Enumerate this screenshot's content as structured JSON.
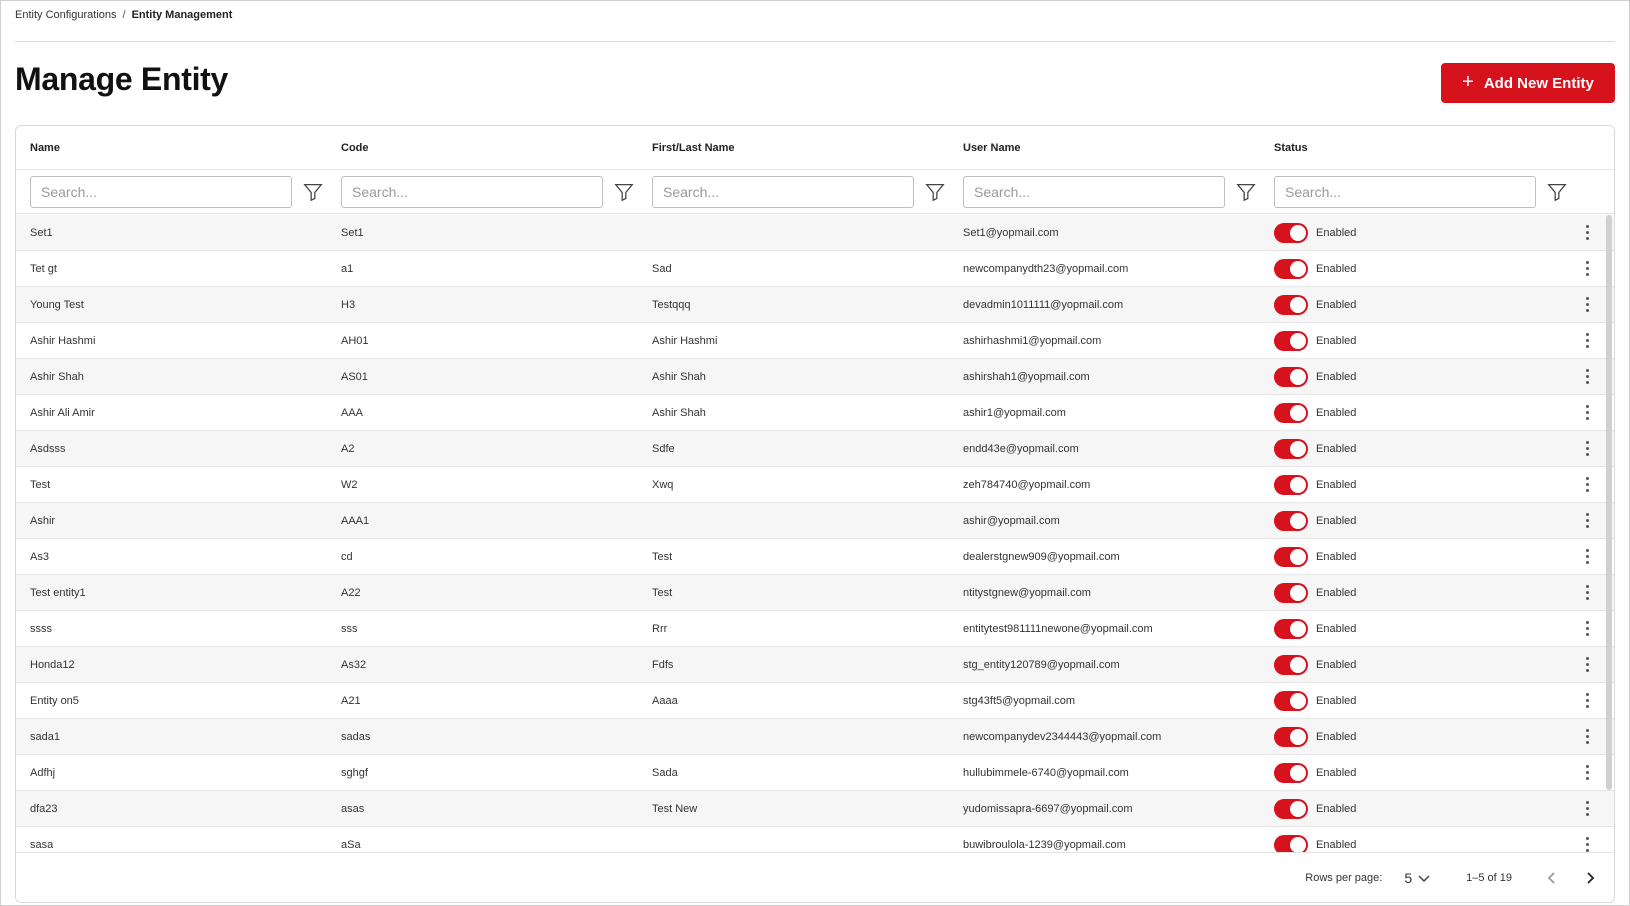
{
  "breadcrumb": {
    "parent": "Entity Configurations",
    "separator": "/",
    "current": "Entity Management"
  },
  "page": {
    "title": "Manage Entity"
  },
  "actions": {
    "add_label": "Add New Entity"
  },
  "table": {
    "columns": {
      "name": "Name",
      "code": "Code",
      "first_last": "First/Last Name",
      "username": "User Name",
      "status": "Status"
    },
    "search_placeholder": "Search...",
    "rows": [
      {
        "name": "Set1",
        "code": "Set1",
        "first_last": "",
        "username": "Set1@yopmail.com",
        "status": "Enabled"
      },
      {
        "name": "Tet gt",
        "code": "a1",
        "first_last": "Sad",
        "username": "newcompanydth23@yopmail.com",
        "status": "Enabled"
      },
      {
        "name": "Young Test",
        "code": "H3",
        "first_last": "Testqqq",
        "username": "devadmin1011111@yopmail.com",
        "status": "Enabled"
      },
      {
        "name": "Ashir Hashmi",
        "code": "AH01",
        "first_last": "Ashir Hashmi",
        "username": "ashirhashmi1@yopmail.com",
        "status": "Enabled"
      },
      {
        "name": "Ashir Shah",
        "code": "AS01",
        "first_last": "Ashir Shah",
        "username": "ashirshah1@yopmail.com",
        "status": "Enabled"
      },
      {
        "name": "Ashir Ali Amir",
        "code": "AAA",
        "first_last": "Ashir Shah",
        "username": "ashir1@yopmail.com",
        "status": "Enabled"
      },
      {
        "name": "Asdsss",
        "code": "A2",
        "first_last": "Sdfe",
        "username": "endd43e@yopmail.com",
        "status": "Enabled"
      },
      {
        "name": "Test",
        "code": "W2",
        "first_last": "Xwq",
        "username": "zeh784740@yopmail.com",
        "status": "Enabled"
      },
      {
        "name": "Ashir",
        "code": "AAA1",
        "first_last": "",
        "username": "ashir@yopmail.com",
        "status": "Enabled"
      },
      {
        "name": "As3",
        "code": "cd",
        "first_last": "Test",
        "username": "dealerstgnew909@yopmail.com",
        "status": "Enabled"
      },
      {
        "name": "Test entity1",
        "code": "A22",
        "first_last": "Test",
        "username": "ntitystgnew@yopmail.com",
        "status": "Enabled"
      },
      {
        "name": "ssss",
        "code": "sss",
        "first_last": "Rrr",
        "username": "entitytest981111newone@yopmail.com",
        "status": "Enabled"
      },
      {
        "name": "Honda12",
        "code": "As32",
        "first_last": "Fdfs",
        "username": "stg_entity120789@yopmail.com",
        "status": "Enabled"
      },
      {
        "name": "Entity on5",
        "code": "A21",
        "first_last": "Aaaa",
        "username": "stg43ft5@yopmail.com",
        "status": "Enabled"
      },
      {
        "name": "sada1",
        "code": "sadas",
        "first_last": "",
        "username": "newcompanydev2344443@yopmail.com",
        "status": "Enabled"
      },
      {
        "name": "Adfhj",
        "code": "sghgf",
        "first_last": "Sada",
        "username": "hullubimmele-6740@yopmail.com",
        "status": "Enabled"
      },
      {
        "name": "dfa23",
        "code": "asas",
        "first_last": "Test New",
        "username": "yudomissapra-6697@yopmail.com",
        "status": "Enabled"
      },
      {
        "name": "sasa",
        "code": "aSa",
        "first_last": "",
        "username": "buwibroulola-1239@yopmail.com",
        "status": "Enabled"
      }
    ]
  },
  "pagination": {
    "rows_per_page_label": "Rows per page:",
    "rows_per_page": "5",
    "range": "1–5 of 19"
  },
  "colors": {
    "accent": "#d6121c"
  },
  "icons": {
    "add": "plus-icon",
    "filter": "filter-icon",
    "row_menu": "kebab-icon",
    "select": "chevron-down-icon",
    "prev": "chevron-left-icon",
    "next": "chevron-right-icon"
  }
}
